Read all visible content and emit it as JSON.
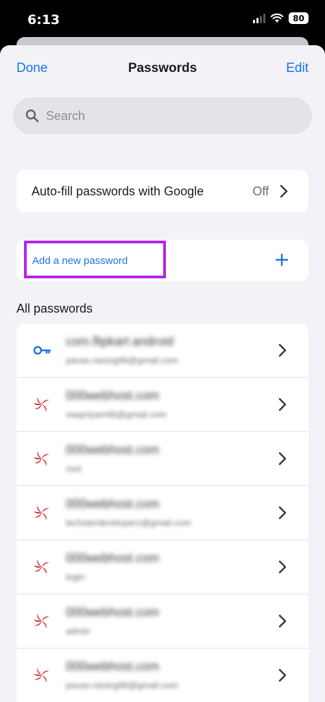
{
  "status_bar": {
    "time": "6:13",
    "battery": "80"
  },
  "nav": {
    "done_label": "Done",
    "title": "Passwords",
    "edit_label": "Edit"
  },
  "search": {
    "placeholder": "Search"
  },
  "autofill": {
    "label": "Auto-fill passwords with Google",
    "value": "Off"
  },
  "add_password": {
    "label": "Add a new password"
  },
  "all_passwords": {
    "header": "All passwords",
    "items": [
      {
        "site": "com.flipkart.android",
        "username": "pavas.raising96@gmail.com",
        "icon": "key-icon"
      },
      {
        "site": "000webhost.com",
        "username": "vaapriyam96@gmail.com",
        "icon": "webhost-icon"
      },
      {
        "site": "000webhost.com",
        "username": "root",
        "icon": "webhost-icon"
      },
      {
        "site": "000webhost.com",
        "username": "techsterdeveloperz@gmail.com",
        "icon": "webhost-icon"
      },
      {
        "site": "000webhost.com",
        "username": "login",
        "icon": "webhost-icon"
      },
      {
        "site": "000webhost.com",
        "username": "admin",
        "icon": "webhost-icon"
      },
      {
        "site": "000webhost.com",
        "username": "pavas.raising96@gmail.com",
        "icon": "webhost-icon"
      }
    ]
  },
  "colors": {
    "accent": "#1a73e8",
    "highlight": "#b624e8",
    "webhost_red": "#d32f2f"
  }
}
